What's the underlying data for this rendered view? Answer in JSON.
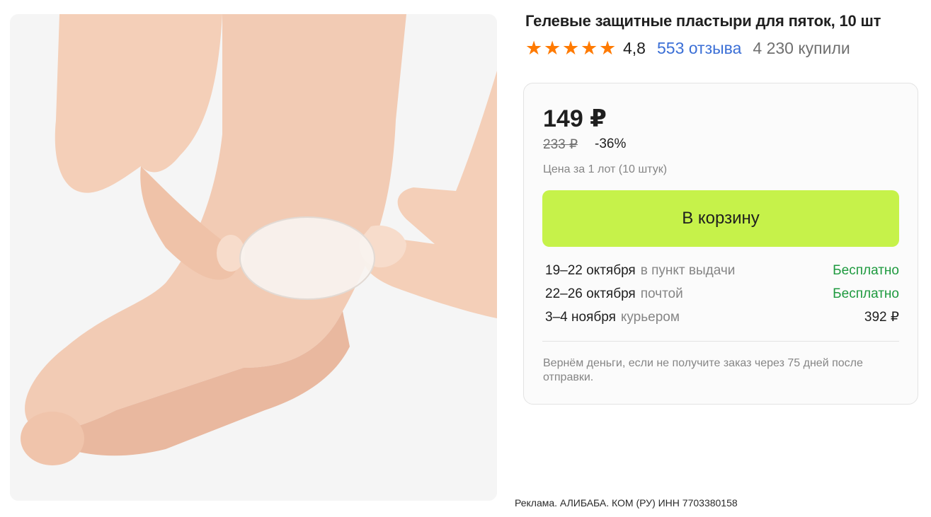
{
  "product": {
    "title": "Гелевые защитные пластыри для пяток, 10 шт",
    "rating": "4,8",
    "reviews": "553 отзыва",
    "bought": "4 230 купили",
    "star_count": 5,
    "star_color": "#ff7a00"
  },
  "pricing": {
    "price": "149 ₽",
    "old_price": "233 ₽",
    "discount": "-36%",
    "lot_note": "Цена за 1 лот (10 штук)"
  },
  "cart": {
    "button_label": "В корзину",
    "button_color": "#c6f24a"
  },
  "delivery": [
    {
      "date": "19–22 октября",
      "method": "в пункт выдачи",
      "price": "Бесплатно",
      "free": true
    },
    {
      "date": "22–26 октября",
      "method": "почтой",
      "price": "Бесплатно",
      "free": true
    },
    {
      "date": "3–4 ноября",
      "method": "курьером",
      "price": "392 ₽",
      "free": false
    }
  ],
  "refund_note": "Вернём деньги, если не получите заказ через 75 дней после отправки.",
  "ad_note": "Реклама. АЛИБАБА. КОМ (РУ) ИНН 7703380158",
  "colors": {
    "link": "#3b6fd6",
    "free": "#1e9a3f"
  }
}
